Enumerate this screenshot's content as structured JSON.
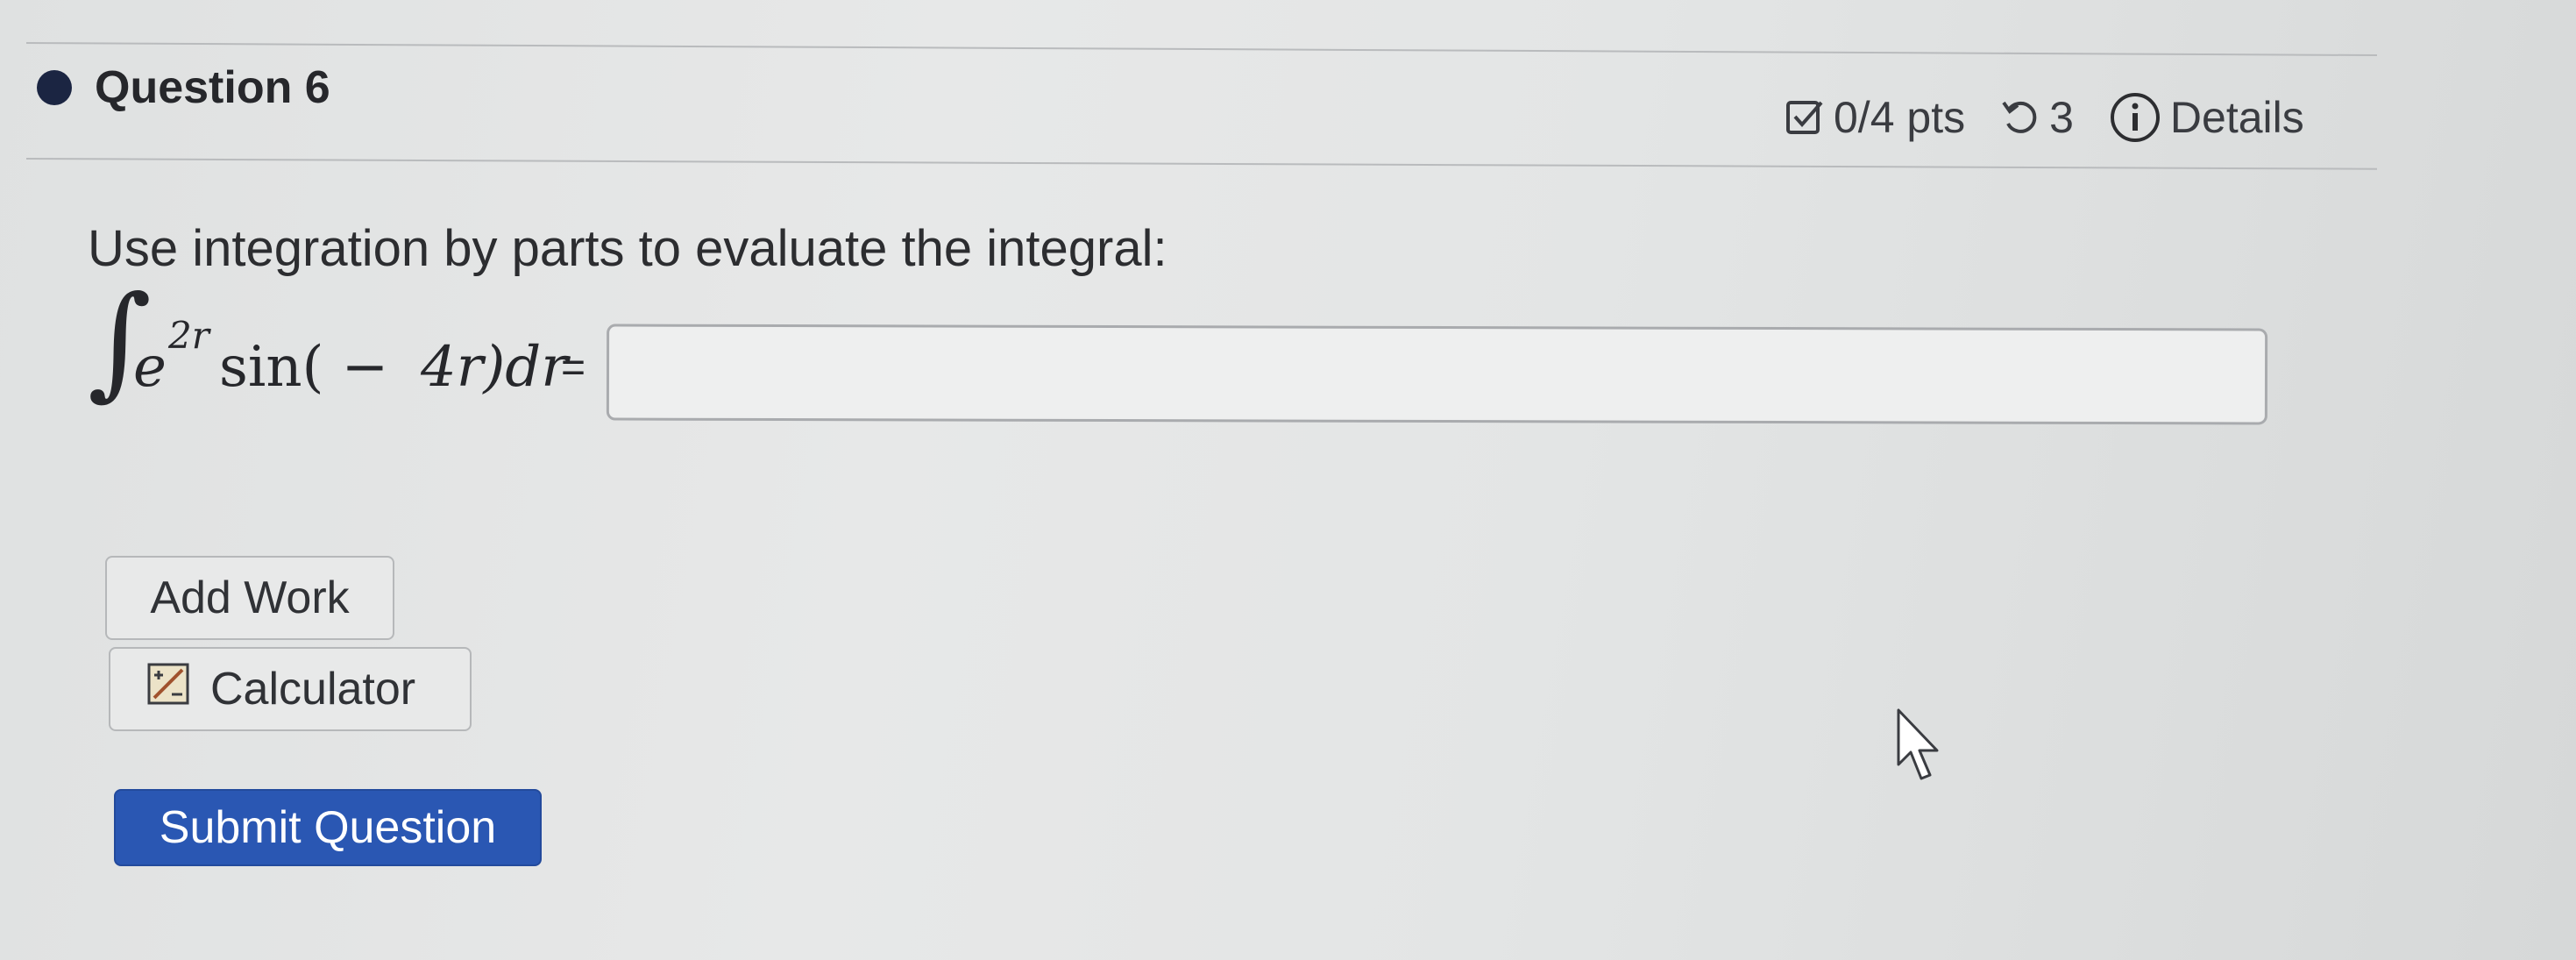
{
  "question": {
    "title": "Question 6",
    "points": "0/4 pts",
    "attempts": "3",
    "details_label": "Details",
    "icons": [
      "checkbox-icon",
      "retry-icon",
      "info-icon"
    ]
  },
  "problem": {
    "prompt": "Use integration by parts to evaluate the integral:",
    "integral_sign": "∫",
    "base": "e",
    "exponent": "2r",
    "func": "sin(",
    "minus": "−",
    "argument": "4r)dr",
    "equals": "=",
    "answer_value": ""
  },
  "buttons": {
    "add_work": "Add Work",
    "calculator": "Calculator",
    "submit": "Submit Question"
  },
  "colors": {
    "bullet": "#1b2542",
    "submit_bg": "#2a57b3",
    "background": "#e3e5e5"
  }
}
